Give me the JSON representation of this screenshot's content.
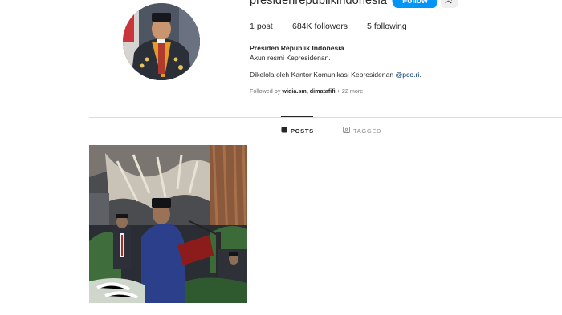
{
  "profile": {
    "username": "presidenrepublikindonesia",
    "follow_label": "Follow",
    "more_label": "···",
    "stats": {
      "posts_count": "1",
      "posts_label": "post",
      "followers_count": "684K",
      "followers_label": "followers",
      "following_count": "5",
      "following_label": "following"
    },
    "bio": {
      "name": "Presiden Republik Indonesia",
      "line1": "Akun resmi Kepresidenan.",
      "managed_prefix": "Dikelola oleh Kantor Komunikasi Kepresidenan ",
      "managed_link": "@pco.ri",
      "managed_suffix": "."
    },
    "followed_by": {
      "prefix": "Followed by ",
      "names": "widia.sm, dimatafifi",
      "suffix": " + 22 more"
    }
  },
  "tabs": [
    {
      "label": "POSTS",
      "active": true
    },
    {
      "label": "TAGGED",
      "active": false
    }
  ],
  "colors": {
    "accent": "#0095f6",
    "verified": "#0095f6",
    "link": "#00376b",
    "muted": "#737373",
    "divider": "#dbdbdb"
  },
  "icons": {
    "verified": "verified-badge-icon",
    "suggest": "add-person-icon",
    "posts_tab": "grid-icon",
    "tagged_tab": "tag-icon"
  }
}
